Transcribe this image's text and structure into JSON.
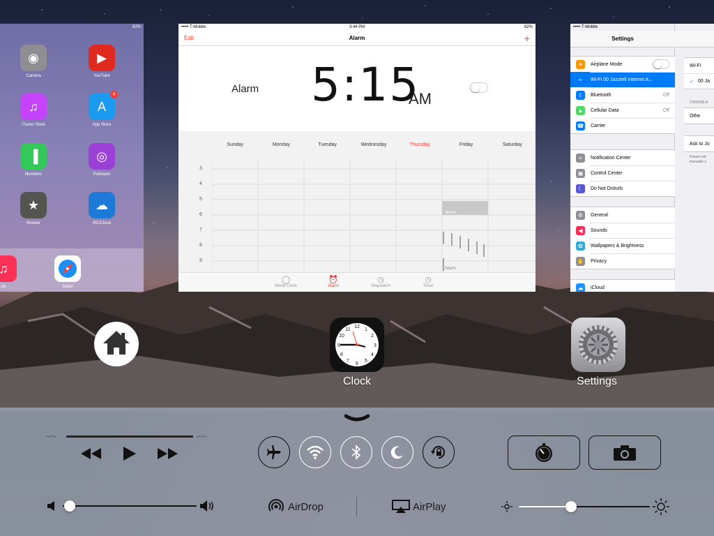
{
  "home_card": {
    "status": {
      "battery": "82%"
    },
    "apps": [
      {
        "name": "Camera",
        "color": "#8e8e93"
      },
      {
        "name": "YouTube",
        "color": "#e02a20"
      },
      {
        "name": "iTunes Store",
        "color": "#c643fc"
      },
      {
        "name": "App Store",
        "color": "#1a9bf0",
        "badge": "4"
      },
      {
        "name": "Numbers",
        "color": "#34c759"
      },
      {
        "name": "Podcasts",
        "color": "#9b40d6"
      },
      {
        "name": "Reeder",
        "color": "#55554f"
      },
      {
        "name": "IRCCloud",
        "color": "#1d7ad6"
      }
    ],
    "dock": {
      "safari": "Safari",
      "music_partial": "sic"
    }
  },
  "clock_card": {
    "status": {
      "carrier": "••••• T-Mobile",
      "time": "3:44 PM",
      "battery": "82%"
    },
    "nav": {
      "edit": "Edit",
      "title": "Alarm",
      "add": "+"
    },
    "alarm": {
      "label": "Alarm",
      "time": "5:15",
      "ampm": "AM",
      "enabled": false
    },
    "days": [
      "Sunday",
      "Monday",
      "Tuesday",
      "Wednesday",
      "Thursday",
      "Friday",
      "Saturday"
    ],
    "today": "Thursday",
    "hours": [
      "3",
      "4",
      "5",
      "6",
      "7",
      "8",
      "9"
    ],
    "events": [
      {
        "day": "Friday",
        "label": "Alarm"
      },
      {
        "day": "Friday",
        "label": "Alarm"
      }
    ],
    "tabs": [
      "World Clock",
      "Alarm",
      "Stopwatch",
      "Timer"
    ],
    "active_tab": "Alarm"
  },
  "settings_card": {
    "status": {
      "carrier": "••••• T-Mobile"
    },
    "title": "Settings",
    "groups": [
      [
        {
          "label": "Airplane Mode",
          "color": "#ff9500",
          "icon": "airplane-icon",
          "toggle": true
        },
        {
          "label": "Wi-Fi  00 Jazztell Internet A...",
          "color": "#007aff",
          "icon": "wifi-icon",
          "selected": true
        },
        {
          "label": "Bluetooth",
          "color": "#007aff",
          "icon": "bluetooth-icon",
          "value": "Off"
        },
        {
          "label": "Cellular Data",
          "color": "#4cd964",
          "icon": "cellular-icon",
          "value": "Off"
        },
        {
          "label": "Carrier",
          "color": "#007aff",
          "icon": "phone-icon"
        }
      ],
      [
        {
          "label": "Notification Center",
          "color": "#8e8e93",
          "icon": "notification-icon"
        },
        {
          "label": "Control Center",
          "color": "#8e8e93",
          "icon": "control-center-icon"
        },
        {
          "label": "Do Not Disturb",
          "color": "#5856d6",
          "icon": "moon-icon"
        }
      ],
      [
        {
          "label": "General",
          "color": "#8e8e93",
          "icon": "gear-icon"
        },
        {
          "label": "Sounds",
          "color": "#ff2d55",
          "icon": "speaker-icon"
        },
        {
          "label": "Wallpapers & Brightness",
          "color": "#34aadc",
          "icon": "flower-icon"
        },
        {
          "label": "Privacy",
          "color": "#8e8e93",
          "icon": "hand-icon"
        }
      ],
      [
        {
          "label": "iCloud",
          "color": "#1e90ff",
          "icon": "cloud-icon"
        }
      ]
    ],
    "detail": {
      "wifi": "Wi-Fi",
      "network": "00 Ja",
      "choose": "CHOOSE A",
      "other": "Othe",
      "ask": "Ask to Jo",
      "known1": "Known net",
      "known2": "manually s"
    }
  },
  "switcher": {
    "apps": [
      {
        "label": "Clock"
      },
      {
        "label": "Settings"
      }
    ]
  },
  "control_center": {
    "media": {
      "elapsed": "--:--",
      "remaining": "--:--"
    },
    "toggles": [
      "airplane-mode",
      "wifi",
      "bluetooth",
      "do-not-disturb",
      "rotation-lock"
    ],
    "airdrop": "AirDrop",
    "airplay": "AirPlay",
    "volume": 0.05,
    "brightness": 0.4
  }
}
